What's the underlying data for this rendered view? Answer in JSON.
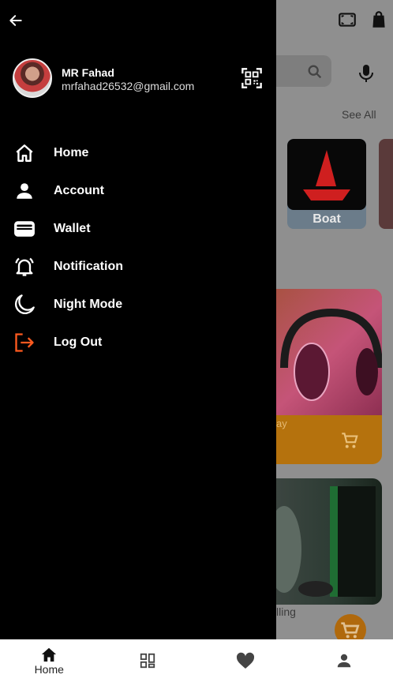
{
  "drawer": {
    "user": {
      "name": "MR Fahad",
      "email": "mrfahad26532@gmail.com"
    },
    "menu": [
      {
        "label": "Home",
        "icon": "home-icon"
      },
      {
        "label": "Account",
        "icon": "person-icon"
      },
      {
        "label": "Wallet",
        "icon": "wallet-icon"
      },
      {
        "label": "Notification",
        "icon": "bell-icon"
      },
      {
        "label": "Night Mode",
        "icon": "moon-icon"
      },
      {
        "label": "Log Out",
        "icon": "logout-icon"
      }
    ],
    "accent_color": "#ff5a1f"
  },
  "background": {
    "see_all": "See All",
    "brand": "Boat",
    "product1_label": "ay",
    "product2_label": "lling"
  },
  "bottom_nav": {
    "items": [
      {
        "label": "Home",
        "icon": "home-icon",
        "active": true
      },
      {
        "label": "",
        "icon": "grid-icon"
      },
      {
        "label": "",
        "icon": "heart-icon"
      },
      {
        "label": "",
        "icon": "person-icon"
      }
    ]
  }
}
